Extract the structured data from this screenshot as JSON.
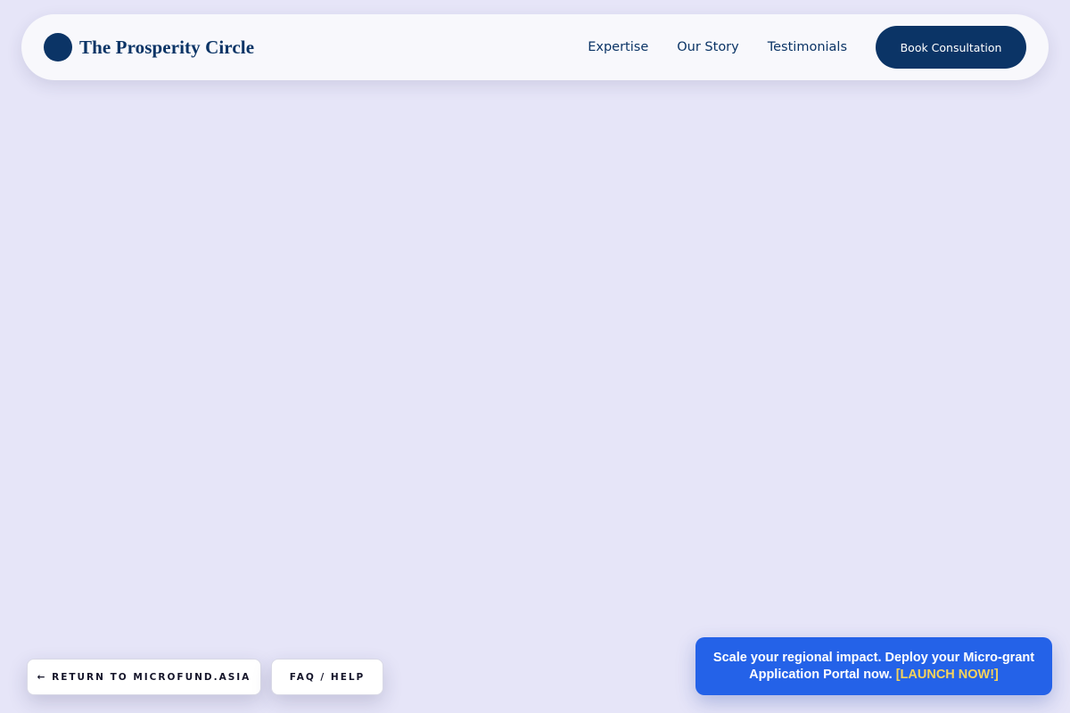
{
  "header": {
    "brand_name": "The Prosperity Circle",
    "logo_icon": "navy-circle-logo",
    "nav": [
      {
        "label": "Expertise"
      },
      {
        "label": "Our Story"
      },
      {
        "label": "Testimonials"
      }
    ],
    "cta_label": "Book Consultation"
  },
  "footer": {
    "return_label": "← RETURN TO MICROFUND.ASIA",
    "faq_label": "FAQ / HELP"
  },
  "promo": {
    "text": "Scale your regional impact. Deploy your Micro-grant Application Portal now.",
    "link_label": "[LAUNCH NOW!]"
  },
  "colors": {
    "page_background": "#e6e5f8",
    "header_background": "#f8f8fc",
    "brand_navy": "#0b3466",
    "promo_blue": "#2462e8",
    "promo_link_yellow": "#f7d35a"
  }
}
